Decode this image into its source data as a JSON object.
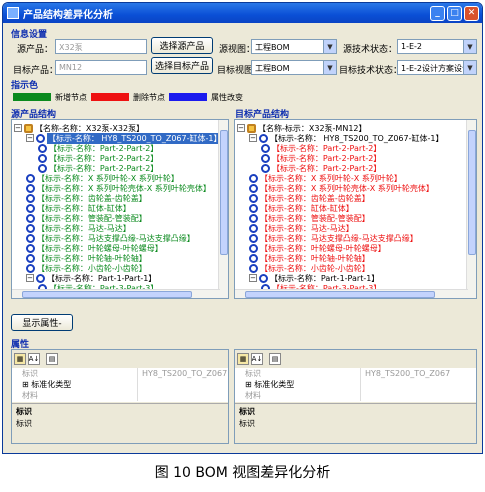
{
  "window": {
    "title": "产品结构差异化分析"
  },
  "info": {
    "section": "信息设置",
    "source_label": "源产品：",
    "source_value": "X32泵",
    "select_source_btn": "选择源产品",
    "source_view_label": "源视图：",
    "source_view_value": "工程BOM",
    "source_tech_label": "源技术状态：",
    "source_tech_value": "1-E-2",
    "target_label": "目标产品：",
    "target_value": "MN12",
    "select_target_btn": "选择目标产品",
    "target_view_label": "目标视图：",
    "target_view_value": "工程BOM",
    "target_tech_label": "目标技术状态：",
    "target_tech_value": "1-E-2设计方案设计"
  },
  "legend": {
    "section": "指示色",
    "items": [
      {
        "label": "新增节点",
        "color": "#0b8a1e"
      },
      {
        "label": "删除节点",
        "color": "#ee1111"
      },
      {
        "label": "属性改变",
        "color": "#1a1aee"
      }
    ]
  },
  "source_tree": {
    "title": "源产品结构",
    "rows": [
      {
        "text": "【名称-名称：X32泵-X32泵】",
        "color": "#000000",
        "indent": 0
      },
      {
        "text": "【标示-名称： HY8_TS200_TO_Z067-缸体-1】",
        "color": "#ffffff",
        "indent": 1
      },
      {
        "text": "【标示-名称：Part-2-Part-2】",
        "color": "#0b8a1e",
        "indent": 2
      },
      {
        "text": "【标示-名称：Part-2-Part-2】",
        "color": "#0b8a1e",
        "indent": 2
      },
      {
        "text": "【标示-名称：Part-2-Part-2】",
        "color": "#0b8a1e",
        "indent": 2
      },
      {
        "text": "【标示-名称：X 系列叶轮-X 系列叶轮】",
        "color": "#0b8a1e",
        "indent": 1
      },
      {
        "text": "【标示-名称：X 系列叶轮壳体-X 系列叶轮壳体】",
        "color": "#0b8a1e",
        "indent": 1
      },
      {
        "text": "【标示-名称：齿轮盖-齿轮盖】",
        "color": "#0b8a1e",
        "indent": 1
      },
      {
        "text": "【标示-名称：缸体-缸体】",
        "color": "#0b8a1e",
        "indent": 1
      },
      {
        "text": "【标示-名称：管装配-管装配】",
        "color": "#0b8a1e",
        "indent": 1
      },
      {
        "text": "【标示-名称：马达-马达】",
        "color": "#0b8a1e",
        "indent": 1
      },
      {
        "text": "【标示-名称：马达支撑凸缘-马达支撑凸缘】",
        "color": "#0b8a1e",
        "indent": 1
      },
      {
        "text": "【标示-名称：叶轮螺母-叶轮螺母】",
        "color": "#0b8a1e",
        "indent": 1
      },
      {
        "text": "【标示-名称：叶轮轴-叶轮轴】",
        "color": "#0b8a1e",
        "indent": 1
      },
      {
        "text": "【标示-名称：小齿轮-小齿轮】",
        "color": "#0b8a1e",
        "indent": 1
      },
      {
        "text": "【标示-名称：Part-1-Part-1】",
        "color": "#000000",
        "indent": 1
      },
      {
        "text": "【标示-名称：Part-3-Part-3】",
        "color": "#0b8a1e",
        "indent": 2
      }
    ]
  },
  "target_tree": {
    "title": "目标产品结构",
    "rows": [
      {
        "text": "【名称-标示：X32泵-MN12】",
        "color": "#000000",
        "indent": 0
      },
      {
        "text": "【标示-名称： HY8_TS200_TO_Z067-缸体-1】",
        "color": "#000000",
        "indent": 1
      },
      {
        "text": "【标示-名称：Part-2-Part-2】",
        "color": "#ee1111",
        "indent": 2
      },
      {
        "text": "【标示-名称：Part-2-Part-2】",
        "color": "#ee1111",
        "indent": 2
      },
      {
        "text": "【标示-名称：Part-2-Part-2】",
        "color": "#ee1111",
        "indent": 2
      },
      {
        "text": "【标示-名称：X 系列叶轮-X 系列叶轮】",
        "color": "#ee1111",
        "indent": 1
      },
      {
        "text": "【标示-名称：X 系列叶轮壳体-X 系列叶轮壳体】",
        "color": "#ee1111",
        "indent": 1
      },
      {
        "text": "【标示-名称：齿轮盖-齿轮盖】",
        "color": "#ee1111",
        "indent": 1
      },
      {
        "text": "【标示-名称：缸体-缸体】",
        "color": "#ee1111",
        "indent": 1
      },
      {
        "text": "【标示-名称：管装配-管装配】",
        "color": "#ee1111",
        "indent": 1
      },
      {
        "text": "【标示-名称：马达-马达】",
        "color": "#ee1111",
        "indent": 1
      },
      {
        "text": "【标示-名称：马达支撑凸缘-马达支撑凸缘】",
        "color": "#ee1111",
        "indent": 1
      },
      {
        "text": "【标示-名称：叶轮螺母-叶轮螺母】",
        "color": "#ee1111",
        "indent": 1
      },
      {
        "text": "【标示-名称：叶轮轴-叶轮轴】",
        "color": "#ee1111",
        "indent": 1
      },
      {
        "text": "【标示-名称：小齿轮-小齿轮】",
        "color": "#ee1111",
        "indent": 1
      },
      {
        "text": "【标示-名称：Part-1-Part-1】",
        "color": "#000000",
        "indent": 1
      },
      {
        "text": "【标示-名称：Part-3-Part-3】",
        "color": "#ee1111",
        "indent": 2
      }
    ]
  },
  "show_props_btn": "显示属性-",
  "props": {
    "section": "属性",
    "left": {
      "rows": [
        {
          "key": "标识",
          "value": "HY8_TS200_TO_Z067"
        },
        {
          "key": "⊞ 标准化类型",
          "value": ""
        },
        {
          "key": "材料",
          "value": ""
        }
      ],
      "desc_title": "标识",
      "desc_text": "标识"
    },
    "right": {
      "rows": [
        {
          "key": "标识",
          "value": "HY8_TS200_TO_Z067"
        },
        {
          "key": "⊞ 标准化类型",
          "value": ""
        },
        {
          "key": "材料",
          "value": ""
        }
      ],
      "desc_title": "标识",
      "desc_text": "标识"
    }
  },
  "caption": "图 10 BOM 视图差异化分析"
}
